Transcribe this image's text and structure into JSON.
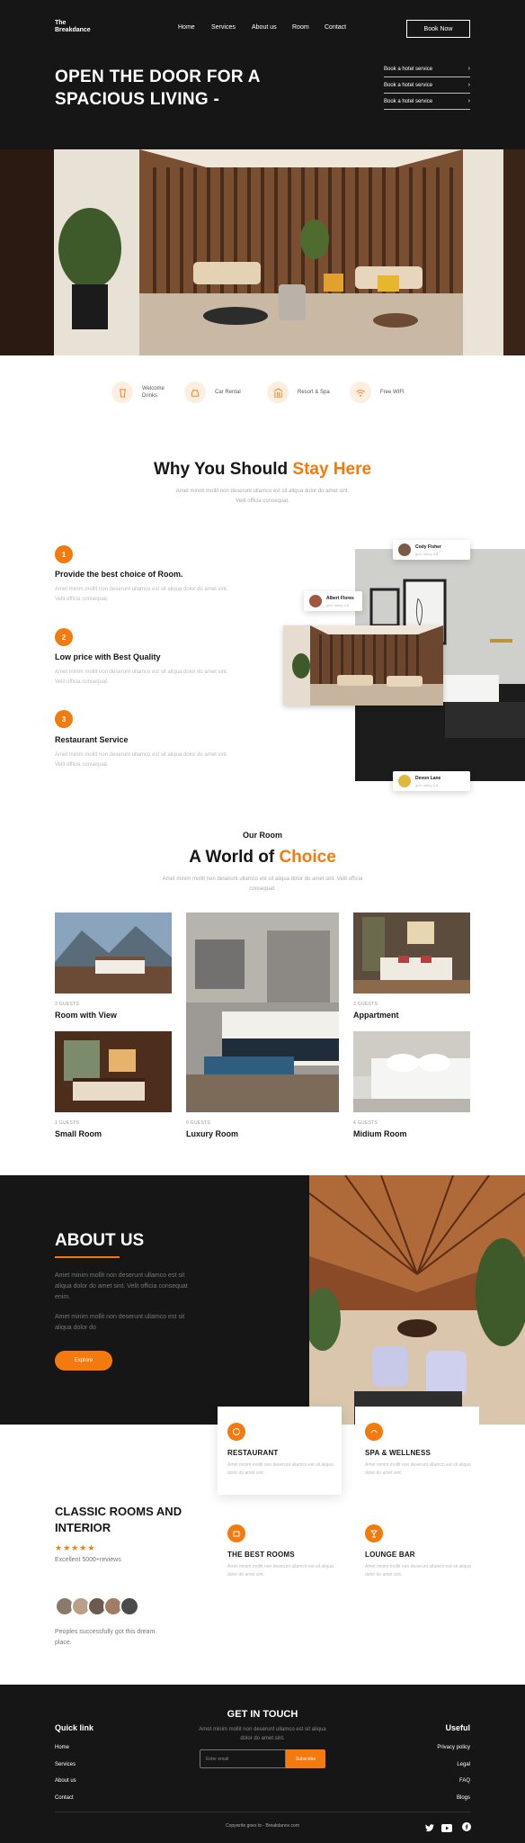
{
  "header": {
    "logo": "The Breakdance",
    "nav": [
      "Home",
      "Services",
      "About us",
      "Room",
      "Contact"
    ],
    "book_now": "Book Now",
    "hero_title": "OPEN THE DOOR FOR A SPACIOUS LIVING -",
    "service_links": [
      "Book a hotel service",
      "Book a hotel service",
      "Book a hotel service"
    ]
  },
  "amenities": [
    {
      "label": "Welcome Drinks",
      "icon": "drink-icon"
    },
    {
      "label": "Car Rental",
      "icon": "car-icon"
    },
    {
      "label": "Resort & Spa",
      "icon": "resort-icon"
    },
    {
      "label": "Free WIFI",
      "icon": "wifi-icon"
    }
  ],
  "why": {
    "title_pre": "Why You Should ",
    "title_accent": "Stay Here",
    "subtitle": "Amet minim mollit non deserunt ullamco est sit aliqua dolor do amet sint. Velit officia consequat.",
    "features": [
      {
        "num": "1",
        "title": "Provide the best choice of Room.",
        "desc": "Amet minim mollit non deserunt ullamco est sit aliqua dolor do amet sint. Velit officia consequat."
      },
      {
        "num": "2",
        "title": "Low price with Best Quality",
        "desc": "Amet minim mollit non deserunt ullamco est sit aliqua dolor do amet sint. Velit officia consequat."
      },
      {
        "num": "3",
        "title": "Restaurant Service",
        "desc": "Amet minim mollit non deserunt ullamco est sit aliqua dolor do amet sint. Velit officia consequat."
      }
    ],
    "reviews": [
      {
        "name": "Cody Fisher",
        "rating": "give rating 4.8"
      },
      {
        "name": "Albert Flores",
        "rating": "give rating 4.8"
      },
      {
        "name": "Devon Lane",
        "rating": "give rating 4.8"
      }
    ]
  },
  "rooms": {
    "eyebrow": "Our Room",
    "title_pre": "A World of ",
    "title_accent": "Choice",
    "subtitle": "Amet minim mollit non deserunt ullamco est sit aliqua dolor do amet sint. Velit officia consequat.",
    "items": [
      {
        "guests": "3 GUESTS",
        "name": "Room with View"
      },
      {
        "guests": "1 GUESTS",
        "name": "Small Room"
      },
      {
        "guests": "6 GUESTS",
        "name": "Luxury Room"
      },
      {
        "guests": "3 GUESTS",
        "name": "Appartment"
      },
      {
        "guests": "4 GUESTS",
        "name": "Midium Room"
      }
    ]
  },
  "about": {
    "title": "ABOUT US",
    "p1": "Amet minim mollit non deserunt ullamco est sit aliqua dolor do amet sint. Velit officia consequat enim.",
    "p2": "Amet minim mollit non deserunt ullamco est sit aliqua dolor do",
    "button": "Explore"
  },
  "classic": {
    "title": "CLASSIC ROOMS AND INTERIOR",
    "stars": 5,
    "reviews": "Excellent 5000+reviews",
    "note": "Peoples successfully got this dream place."
  },
  "services": [
    {
      "title": "RESTAURANT",
      "desc": "Amet minim mollit non deserunt ullamco est sit aliqua dolor do amet sint.",
      "icon": "restaurant-icon"
    },
    {
      "title": "SPA & WELLNESS",
      "desc": "Amet minim mollit non deserunt ullamco est sit aliqua dolor do amet sint.",
      "icon": "spa-icon"
    },
    {
      "title": "THE BEST ROOMS",
      "desc": "Amet minim mollit non deserunt ullamco est sit aliqua dolor do amet sint.",
      "icon": "room-icon"
    },
    {
      "title": "LOUNGE BAR",
      "desc": "Amet minim mollit non deserunt ullamco est sit aliqua dolor do amet sint.",
      "icon": "bar-icon"
    }
  ],
  "footer": {
    "quick_title": "Quick link",
    "quick_links": [
      "Home",
      "Services",
      "About us",
      "Contact"
    ],
    "contact_title": "GET IN TOUCH",
    "contact_text": "Amet minim mollit non deserunt ullamco est sit aliqua dolor do amet sint.",
    "email_placeholder": "Enter email",
    "subscribe": "Subscribe",
    "useful_title": "Useful",
    "useful_links": [
      "Privacy policy",
      "Legal",
      "FAQ",
      "Blogs"
    ],
    "copyright": "Copywrite goes to - Breakdance.com"
  },
  "colors": {
    "accent": "#f47a0d",
    "dark": "#161616"
  }
}
